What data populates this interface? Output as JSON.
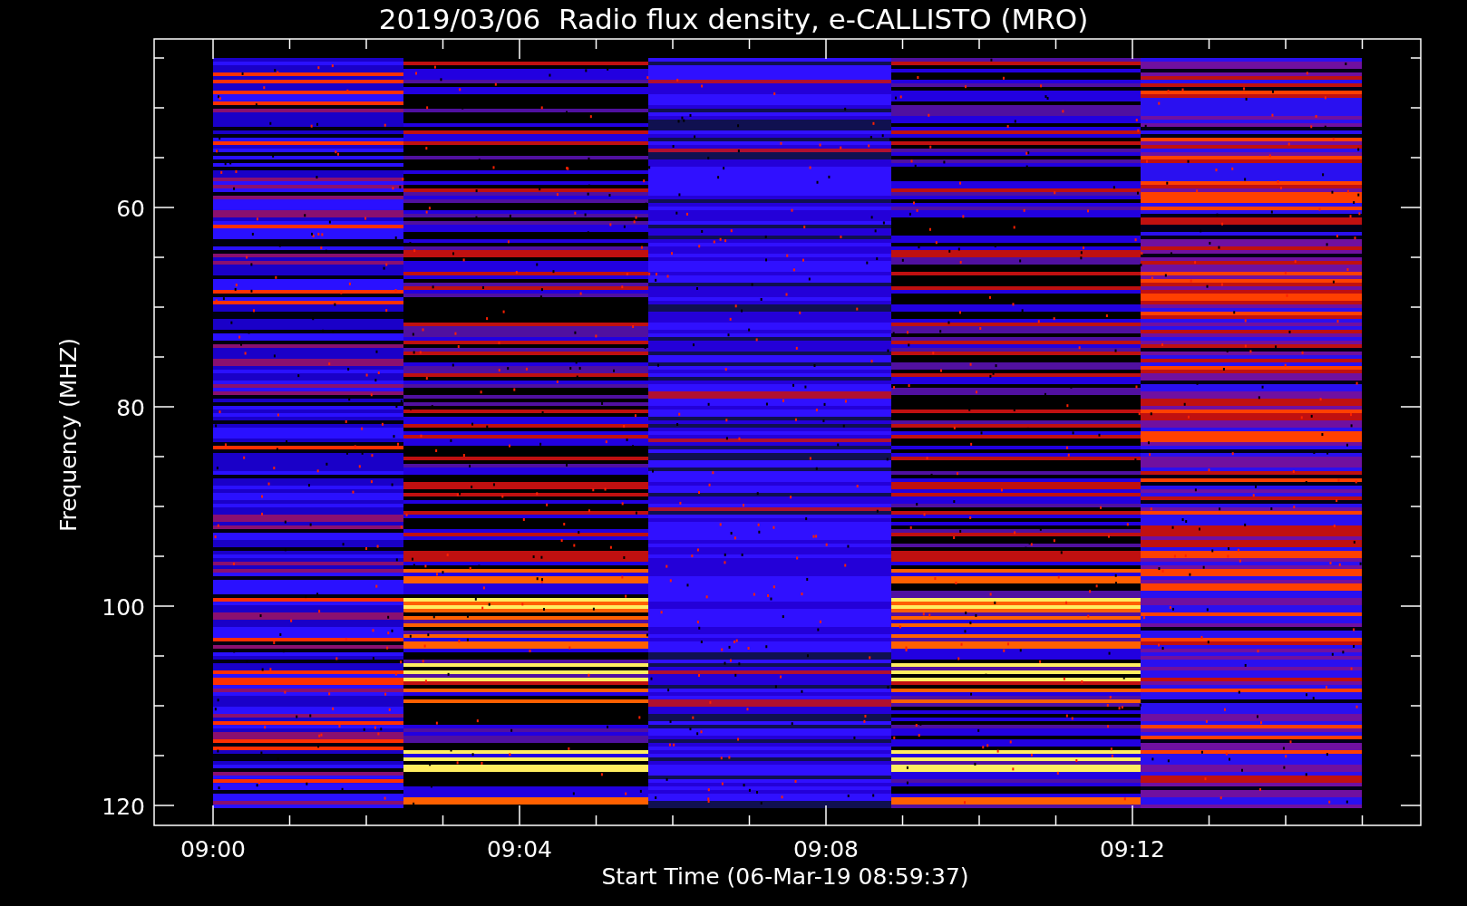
{
  "title": "2019/03/06  Radio flux density, e-CALLISTO (MRO)",
  "y_axis": {
    "label": "Frequency (MHZ)",
    "tick_labels": [
      "60",
      "80",
      "100",
      "120"
    ]
  },
  "x_axis": {
    "label": "Start Time (06-Mar-19 08:59:37)",
    "tick_labels": [
      "09:00",
      "09:04",
      "09:08",
      "09:12"
    ]
  }
}
